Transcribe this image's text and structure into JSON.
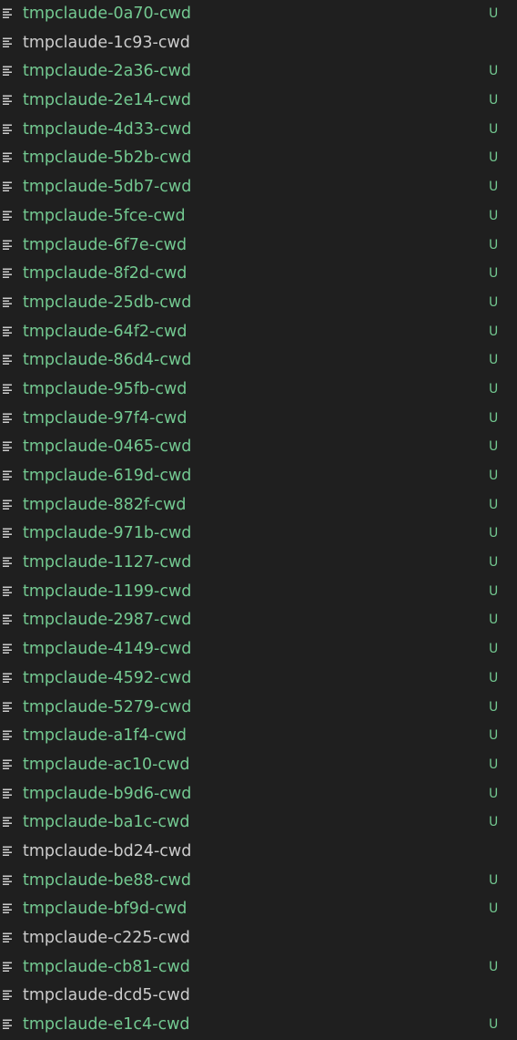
{
  "explorer": {
    "items": [
      {
        "icon": "text-file-icon",
        "name": "tmpclaude-0a70-cwd",
        "status": "U",
        "color": "#73c991"
      },
      {
        "icon": "text-file-icon",
        "name": "tmpclaude-1c93-cwd",
        "status": "",
        "color": "#cccccc"
      },
      {
        "icon": "text-file-icon",
        "name": "tmpclaude-2a36-cwd",
        "status": "U",
        "color": "#73c991"
      },
      {
        "icon": "text-file-icon",
        "name": "tmpclaude-2e14-cwd",
        "status": "U",
        "color": "#73c991"
      },
      {
        "icon": "text-file-icon",
        "name": "tmpclaude-4d33-cwd",
        "status": "U",
        "color": "#73c991"
      },
      {
        "icon": "text-file-icon",
        "name": "tmpclaude-5b2b-cwd",
        "status": "U",
        "color": "#73c991"
      },
      {
        "icon": "text-file-icon",
        "name": "tmpclaude-5db7-cwd",
        "status": "U",
        "color": "#73c991"
      },
      {
        "icon": "text-file-icon",
        "name": "tmpclaude-5fce-cwd",
        "status": "U",
        "color": "#73c991"
      },
      {
        "icon": "text-file-icon",
        "name": "tmpclaude-6f7e-cwd",
        "status": "U",
        "color": "#73c991"
      },
      {
        "icon": "text-file-icon",
        "name": "tmpclaude-8f2d-cwd",
        "status": "U",
        "color": "#73c991"
      },
      {
        "icon": "text-file-icon",
        "name": "tmpclaude-25db-cwd",
        "status": "U",
        "color": "#73c991"
      },
      {
        "icon": "text-file-icon",
        "name": "tmpclaude-64f2-cwd",
        "status": "U",
        "color": "#73c991"
      },
      {
        "icon": "text-file-icon",
        "name": "tmpclaude-86d4-cwd",
        "status": "U",
        "color": "#73c991"
      },
      {
        "icon": "text-file-icon",
        "name": "tmpclaude-95fb-cwd",
        "status": "U",
        "color": "#73c991"
      },
      {
        "icon": "text-file-icon",
        "name": "tmpclaude-97f4-cwd",
        "status": "U",
        "color": "#73c991"
      },
      {
        "icon": "text-file-icon",
        "name": "tmpclaude-0465-cwd",
        "status": "U",
        "color": "#73c991"
      },
      {
        "icon": "text-file-icon",
        "name": "tmpclaude-619d-cwd",
        "status": "U",
        "color": "#73c991"
      },
      {
        "icon": "text-file-icon",
        "name": "tmpclaude-882f-cwd",
        "status": "U",
        "color": "#73c991"
      },
      {
        "icon": "text-file-icon",
        "name": "tmpclaude-971b-cwd",
        "status": "U",
        "color": "#73c991"
      },
      {
        "icon": "text-file-icon",
        "name": "tmpclaude-1127-cwd",
        "status": "U",
        "color": "#73c991"
      },
      {
        "icon": "text-file-icon",
        "name": "tmpclaude-1199-cwd",
        "status": "U",
        "color": "#73c991"
      },
      {
        "icon": "text-file-icon",
        "name": "tmpclaude-2987-cwd",
        "status": "U",
        "color": "#73c991"
      },
      {
        "icon": "text-file-icon",
        "name": "tmpclaude-4149-cwd",
        "status": "U",
        "color": "#73c991"
      },
      {
        "icon": "text-file-icon",
        "name": "tmpclaude-4592-cwd",
        "status": "U",
        "color": "#73c991"
      },
      {
        "icon": "text-file-icon",
        "name": "tmpclaude-5279-cwd",
        "status": "U",
        "color": "#73c991"
      },
      {
        "icon": "text-file-icon",
        "name": "tmpclaude-a1f4-cwd",
        "status": "U",
        "color": "#73c991"
      },
      {
        "icon": "text-file-icon",
        "name": "tmpclaude-ac10-cwd",
        "status": "U",
        "color": "#73c991"
      },
      {
        "icon": "text-file-icon",
        "name": "tmpclaude-b9d6-cwd",
        "status": "U",
        "color": "#73c991"
      },
      {
        "icon": "text-file-icon",
        "name": "tmpclaude-ba1c-cwd",
        "status": "U",
        "color": "#73c991"
      },
      {
        "icon": "text-file-icon",
        "name": "tmpclaude-bd24-cwd",
        "status": "",
        "color": "#cccccc"
      },
      {
        "icon": "text-file-icon",
        "name": "tmpclaude-be88-cwd",
        "status": "U",
        "color": "#73c991"
      },
      {
        "icon": "text-file-icon",
        "name": "tmpclaude-bf9d-cwd",
        "status": "U",
        "color": "#73c991"
      },
      {
        "icon": "text-file-icon",
        "name": "tmpclaude-c225-cwd",
        "status": "",
        "color": "#cccccc"
      },
      {
        "icon": "text-file-icon",
        "name": "tmpclaude-cb81-cwd",
        "status": "U",
        "color": "#73c991"
      },
      {
        "icon": "text-file-icon",
        "name": "tmpclaude-dcd5-cwd",
        "status": "",
        "color": "#cccccc"
      },
      {
        "icon": "text-file-icon",
        "name": "tmpclaude-e1c4-cwd",
        "status": "U",
        "color": "#73c991"
      }
    ]
  },
  "colors": {
    "background": "#1f1f1f",
    "untracked": "#73c991",
    "default_text": "#cccccc",
    "icon": "#cccccc"
  }
}
